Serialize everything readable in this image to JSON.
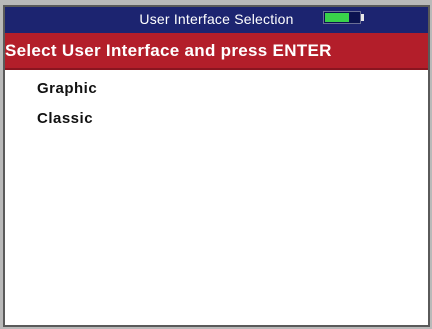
{
  "window": {
    "title": "User Interface Selection",
    "battery": {
      "level": 0.72,
      "color": "#39d24a"
    }
  },
  "header": {
    "instruction": "Select User Interface and press ENTER",
    "color": "#b31e2a"
  },
  "menu": {
    "items": [
      {
        "label": "Graphic"
      },
      {
        "label": "Classic"
      }
    ]
  },
  "colors": {
    "titlebar": "#1c2470",
    "background": "#ffffff"
  }
}
